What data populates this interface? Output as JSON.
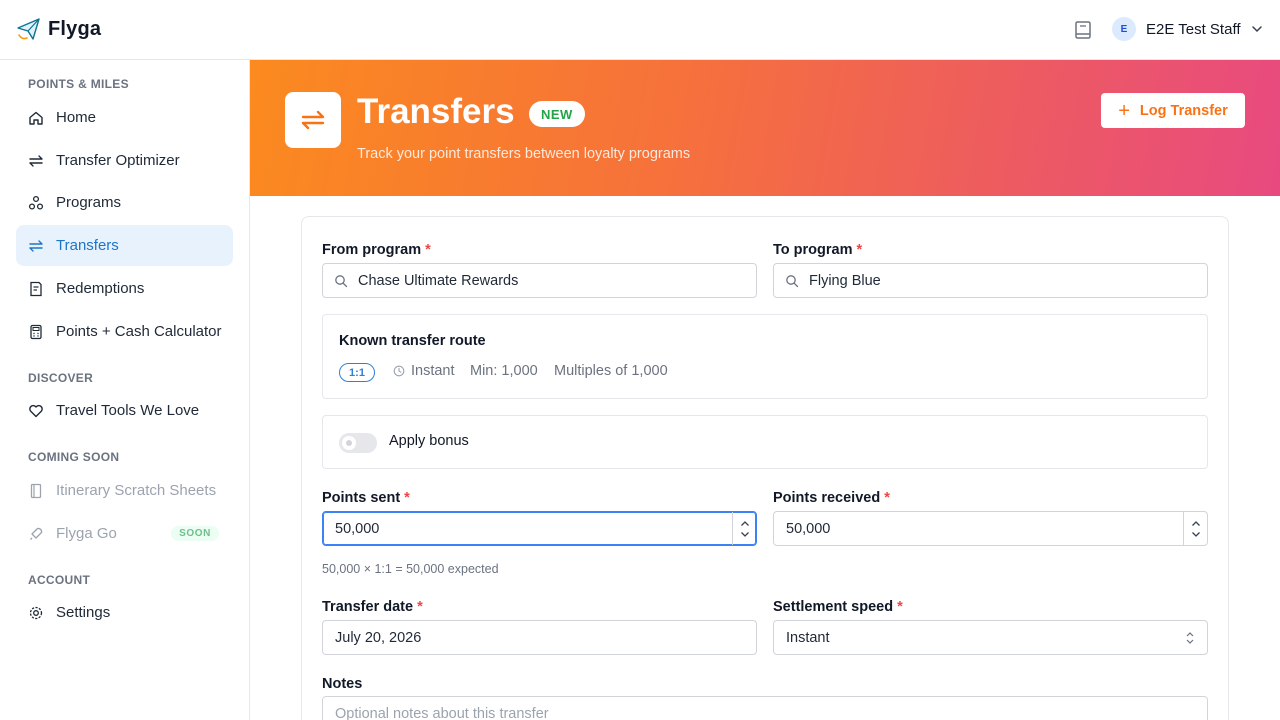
{
  "app": {
    "name": "Flyga"
  },
  "user": {
    "initial": "E",
    "name": "E2E Test Staff"
  },
  "sidebar": {
    "sections": [
      {
        "label": "POINTS & MILES"
      },
      {
        "label": "DISCOVER"
      },
      {
        "label": "COMING SOON"
      },
      {
        "label": "ACCOUNT"
      }
    ],
    "items": [
      {
        "label": "Home",
        "icon": "home-icon"
      },
      {
        "label": "Transfer Optimizer",
        "icon": "arrows-exchange-icon"
      },
      {
        "label": "Programs",
        "icon": "programs-icon"
      },
      {
        "label": "Transfers",
        "icon": "arrows-exchange-icon",
        "active": true
      },
      {
        "label": "Redemptions",
        "icon": "receipt-icon"
      },
      {
        "label": "Points + Cash Calculator",
        "icon": "calculator-icon"
      },
      {
        "label": "Travel Tools We Love",
        "icon": "heart-icon"
      },
      {
        "label": "Itinerary Scratch Sheets",
        "icon": "notebook-icon",
        "disabled": true
      },
      {
        "label": "Flyga Go",
        "icon": "rocket-icon",
        "disabled": true,
        "badge": "SOON"
      },
      {
        "label": "Settings",
        "icon": "gear-icon"
      }
    ]
  },
  "header": {
    "title": "Transfers",
    "badge": "NEW",
    "subtitle": "Track your point transfers between loyalty programs",
    "action_label": "Log Transfer"
  },
  "form": {
    "from_label": "From program",
    "from_value": "Chase Ultimate Rewards",
    "to_label": "To program",
    "to_value": "Flying Blue",
    "route": {
      "title": "Known transfer route",
      "ratio": "1:1",
      "speed": "Instant",
      "min": "Min: 1,000",
      "multiples": "Multiples of 1,000"
    },
    "bonus_label": "Apply bonus",
    "bonus_enabled": false,
    "points_sent_label": "Points sent",
    "points_sent_value": "50,000",
    "points_received_label": "Points received",
    "points_received_value": "50,000",
    "calc_hint": "50,000 × 1:1 = 50,000 expected",
    "date_label": "Transfer date",
    "date_value": "July 20, 2026",
    "speed_label": "Settlement speed",
    "speed_value": "Instant",
    "notes_label": "Notes",
    "notes_placeholder": "Optional notes about this transfer",
    "required_mark": "*"
  },
  "colors": {
    "accent": "#f97316",
    "active_nav": "#1d74c9",
    "gradient_start": "#fb8a1f",
    "gradient_end": "#e84a80",
    "required": "#ef4444"
  }
}
